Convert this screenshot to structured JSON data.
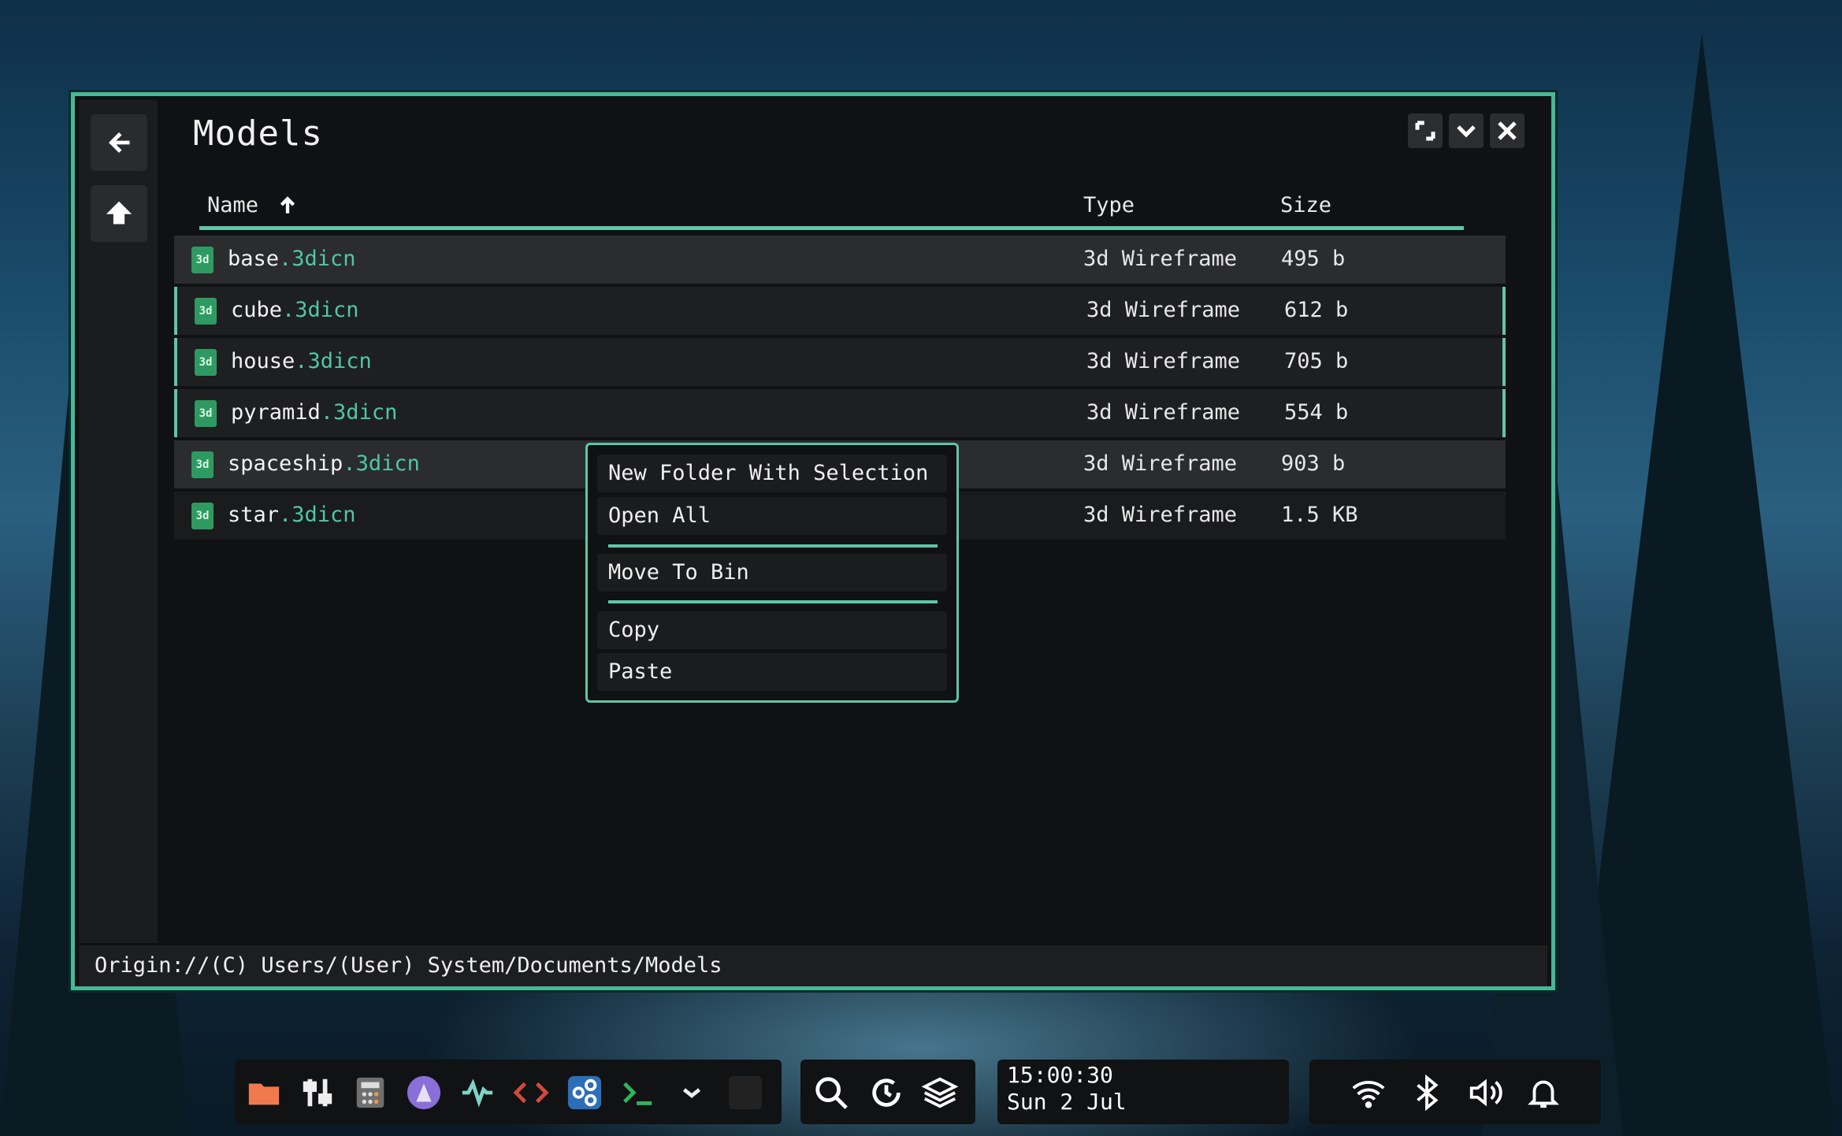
{
  "window": {
    "title": "Models",
    "status_path": "Origin://(C) Users/(User) System/Documents/Models"
  },
  "columns": {
    "name": "Name",
    "type": "Type",
    "size": "Size"
  },
  "files": [
    {
      "stem": "base",
      "ext": ".3dicn",
      "type": "3d Wireframe",
      "size": "495 b"
    },
    {
      "stem": "cube",
      "ext": ".3dicn",
      "type": "3d Wireframe",
      "size": "612 b"
    },
    {
      "stem": "house",
      "ext": ".3dicn",
      "type": "3d Wireframe",
      "size": "705 b"
    },
    {
      "stem": "pyramid",
      "ext": ".3dicn",
      "type": "3d Wireframe",
      "size": "554 b"
    },
    {
      "stem": "spaceship",
      "ext": ".3dicn",
      "type": "3d Wireframe",
      "size": "903 b"
    },
    {
      "stem": "star",
      "ext": ".3dicn",
      "type": "3d Wireframe",
      "size": "1.5 KB"
    }
  ],
  "file_icon_label": "3d",
  "context_menu": {
    "new_folder": "New Folder With Selection",
    "open_all": "Open All",
    "move_to_bin": "Move To Bin",
    "copy": "Copy",
    "paste": "Paste"
  },
  "taskbar": {
    "clock_time": "15:00:30",
    "clock_date": "Sun 2 Jul",
    "apps": [
      "folder-icon",
      "mixer-icon",
      "calculator-icon",
      "ghost-icon",
      "activity-icon",
      "code-icon",
      "nodes-icon",
      "terminal-icon",
      "chevron-icon",
      "blank-app"
    ],
    "tools": [
      "search-icon",
      "refresh-icon",
      "layers-icon"
    ],
    "tray": [
      "wifi-icon",
      "bluetooth-icon",
      "volume-icon",
      "bell-icon"
    ]
  },
  "colors": {
    "accent": "#5ec7a8",
    "window_border": "#48b79a",
    "file_icon": "#2e9a62"
  }
}
